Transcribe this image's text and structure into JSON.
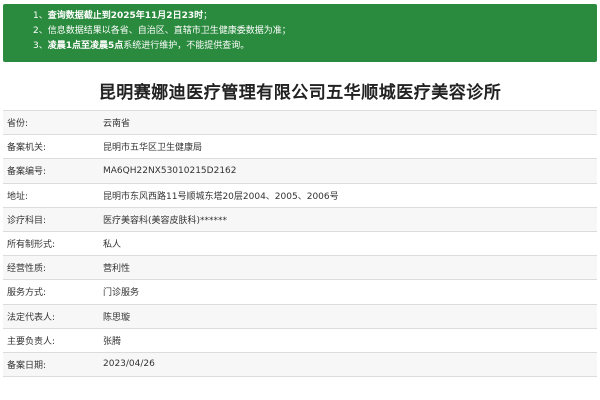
{
  "notice": {
    "lines": [
      {
        "prefix": "1、",
        "bold": "查询数据截止到2025年11月2日23时",
        "rest": "；"
      },
      {
        "prefix": "2、",
        "bold": "",
        "rest": "信息数据结果以各省、自治区、直辖市卫生健康委数据为准；"
      },
      {
        "prefix": "3、",
        "bold": "凌晨1点至凌晨5点",
        "rest": "系统进行维护，不能提供查询。"
      }
    ]
  },
  "title": "昆明赛娜迪医疗管理有限公司五华顺城医疗美容诊所",
  "rows": [
    {
      "label": "省份:",
      "value": "云南省"
    },
    {
      "label": "备案机关:",
      "value": "昆明市五华区卫生健康局"
    },
    {
      "label": "备案编号:",
      "value": "MA6QH22NX53010215D2162"
    },
    {
      "label": "地址:",
      "value": "昆明市东风西路11号顺城东塔20层2004、2005、2006号"
    },
    {
      "label": "诊疗科目:",
      "value": "医疗美容科(美容皮肤科)******"
    },
    {
      "label": "所有制形式:",
      "value": "私人"
    },
    {
      "label": "经营性质:",
      "value": "营利性"
    },
    {
      "label": "服务方式:",
      "value": "门诊服务"
    },
    {
      "label": "法定代表人:",
      "value": "陈思璇"
    },
    {
      "label": "主要负责人:",
      "value": "张腾"
    },
    {
      "label": "备案日期:",
      "value": "2023/04/26"
    }
  ]
}
